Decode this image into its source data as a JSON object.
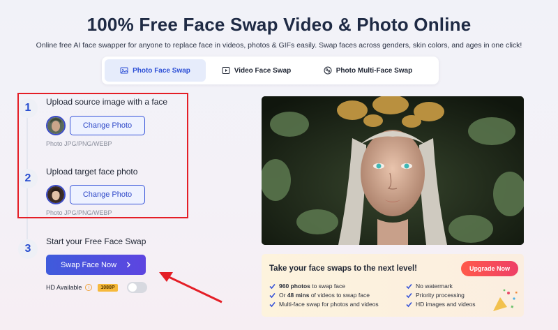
{
  "header": {
    "title": "100% Free Face Swap Video & Photo Online",
    "subtitle": "Online free AI face swapper for anyone to replace face in videos, photos & GIFs easily. Swap faces across genders, skin colors, and ages in one click!"
  },
  "tabs": [
    {
      "label": "Photo Face Swap",
      "icon": "image-icon",
      "active": true
    },
    {
      "label": "Video Face Swap",
      "icon": "video-play-icon",
      "active": false
    },
    {
      "label": "Photo Multi-Face Swap",
      "icon": "multi-face-icon",
      "active": false
    }
  ],
  "steps": [
    {
      "number": "1",
      "title": "Upload source image with a face",
      "button": "Change Photo",
      "hint": "Photo JPG/PNG/WEBP"
    },
    {
      "number": "2",
      "title": "Upload target face photo",
      "button": "Change Photo",
      "hint": "Photo JPG/PNG/WEBP"
    },
    {
      "number": "3",
      "title": "Start your Free Face Swap",
      "button": "Swap Face Now"
    }
  ],
  "hd": {
    "label": "HD Available",
    "badge": "1080P",
    "enabled": false
  },
  "promo": {
    "title": "Take your face swaps to the next level!",
    "button": "Upgrade Now",
    "features_left": [
      {
        "bold": "960 photos",
        "text": " to swap face",
        "prefix": ""
      },
      {
        "bold": "48 mins",
        "text": " of videos to swap face",
        "prefix": "Or "
      },
      {
        "bold": "",
        "text": "Multi-face swap for photos and videos",
        "prefix": ""
      }
    ],
    "features_right": [
      "No watermark",
      "Priority processing",
      "HD images and videos"
    ]
  },
  "colors": {
    "accent": "#3653d8",
    "annotation_red": "#e41e26",
    "upgrade": "#ff5a4a"
  }
}
